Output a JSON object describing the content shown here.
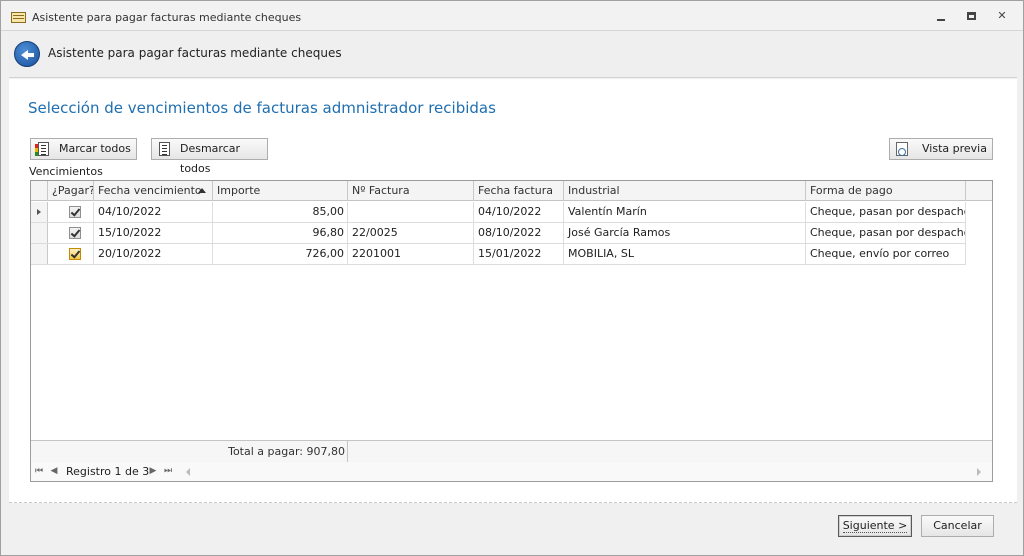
{
  "window": {
    "title": "Asistente para pagar facturas mediante cheques"
  },
  "wizard": {
    "header_title": "Asistente para pagar facturas mediante cheques"
  },
  "page": {
    "heading": "Selección de vencimientos de facturas admnistrador recibidas"
  },
  "toolbar": {
    "marcar_label": "Marcar todos",
    "desmarcar_label": "Desmarcar todos",
    "vista_label": "Vista previa"
  },
  "grid": {
    "group_label": "Vencimientos",
    "columns": [
      "¿Pagar?",
      "Fecha vencimiento",
      "Importe",
      "Nº Factura",
      "Fecha factura",
      "Industrial",
      "Forma de pago"
    ],
    "sorted_column": "Fecha vencimiento",
    "rows": [
      {
        "pagar": true,
        "fecha_vencimiento": "04/10/2022",
        "importe": "85,00",
        "n_factura": "",
        "fecha_factura": "04/10/2022",
        "industrial": "Valentín Marín",
        "forma_pago": "Cheque, pasan por despacho"
      },
      {
        "pagar": true,
        "fecha_vencimiento": "15/10/2022",
        "importe": "96,80",
        "n_factura": "22/0025",
        "fecha_factura": "08/10/2022",
        "industrial": "José García Ramos",
        "forma_pago": "Cheque, pasan por despacho"
      },
      {
        "pagar": true,
        "fecha_vencimiento": "20/10/2022",
        "importe": "726,00",
        "n_factura": "2201001",
        "fecha_factura": "15/01/2022",
        "industrial": "MOBILIA, SL",
        "forma_pago": "Cheque, envío por correo"
      }
    ],
    "total_label": "Total a pagar: 907,80",
    "navigator": {
      "record_text": "Registro 1 de 3"
    }
  },
  "footer": {
    "next_label": "Siguiente >",
    "cancel_label": "Cancelar"
  },
  "icons": {
    "app": "window-form-icon",
    "back": "back-arrow-icon",
    "marcar": "checklist-icon",
    "desmarcar": "list-icon",
    "vista": "print-preview-icon"
  },
  "colors": {
    "heading": "#1f6fb0",
    "checkbox_highlight": "#f5c94a"
  }
}
